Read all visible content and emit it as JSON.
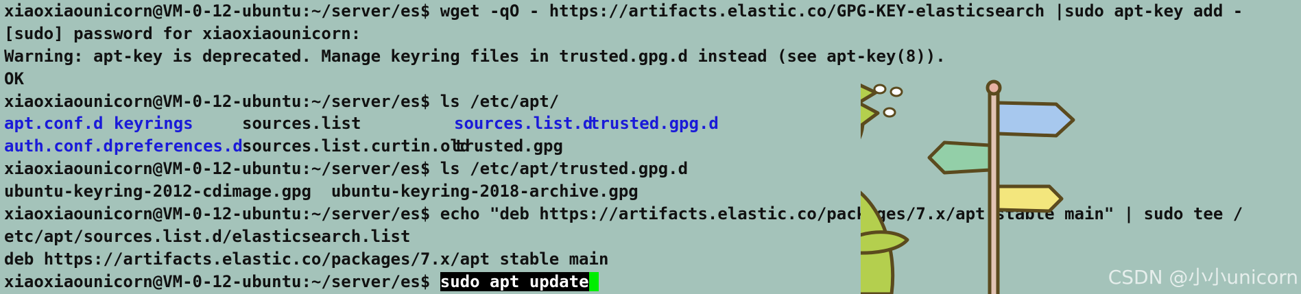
{
  "terminal": {
    "prompt": "xiaoxiaounicorn@VM-0-12-ubuntu:~/server/es$",
    "lines": [
      {
        "type": "command",
        "command": "wget -qO - https://artifacts.elastic.co/GPG-KEY-elasticsearch |sudo apt-key add -"
      },
      {
        "type": "output",
        "text": "[sudo] password for xiaoxiaounicorn:"
      },
      {
        "type": "output",
        "text": "Warning: apt-key is deprecated. Manage keyring files in trusted.gpg.d instead (see apt-key(8))."
      },
      {
        "type": "output",
        "text": "OK"
      },
      {
        "type": "command",
        "command": "ls /etc/apt/"
      },
      {
        "type": "listing",
        "entries": [
          {
            "name": "apt.conf.d",
            "kind": "dir"
          },
          {
            "name": "keyrings",
            "kind": "dir"
          },
          {
            "name": "sources.list",
            "kind": "file"
          },
          {
            "name": "sources.list.d",
            "kind": "dir"
          },
          {
            "name": "trusted.gpg.d",
            "kind": "dir"
          }
        ]
      },
      {
        "type": "listing",
        "entries": [
          {
            "name": "auth.conf.d",
            "kind": "dir"
          },
          {
            "name": "preferences.d",
            "kind": "dir"
          },
          {
            "name": "sources.list.curtin.old",
            "kind": "file"
          },
          {
            "name": "trusted.gpg",
            "kind": "file"
          }
        ]
      },
      {
        "type": "command",
        "command": "ls /etc/apt/trusted.gpg.d"
      },
      {
        "type": "output",
        "text": "ubuntu-keyring-2012-cdimage.gpg  ubuntu-keyring-2018-archive.gpg"
      },
      {
        "type": "command",
        "command": "echo \"deb https://artifacts.elastic.co/packages/7.x/apt stable main\" | sudo tee /"
      },
      {
        "type": "output",
        "text": "etc/apt/sources.list.d/elasticsearch.list"
      },
      {
        "type": "output",
        "text": "deb https://artifacts.elastic.co/packages/7.x/apt stable main"
      },
      {
        "type": "current",
        "command": "sudo apt update"
      }
    ]
  },
  "watermark": "CSDN @小小unicorn",
  "colors": {
    "background": "#a4c3ba",
    "text": "#111111",
    "directory": "#1a1ad8",
    "cursor": "#00ee00",
    "selection_bg": "#000000",
    "selection_fg": "#ffffff"
  },
  "decoration": {
    "mascot": "green-dinosaur-with-signpost-icon"
  }
}
